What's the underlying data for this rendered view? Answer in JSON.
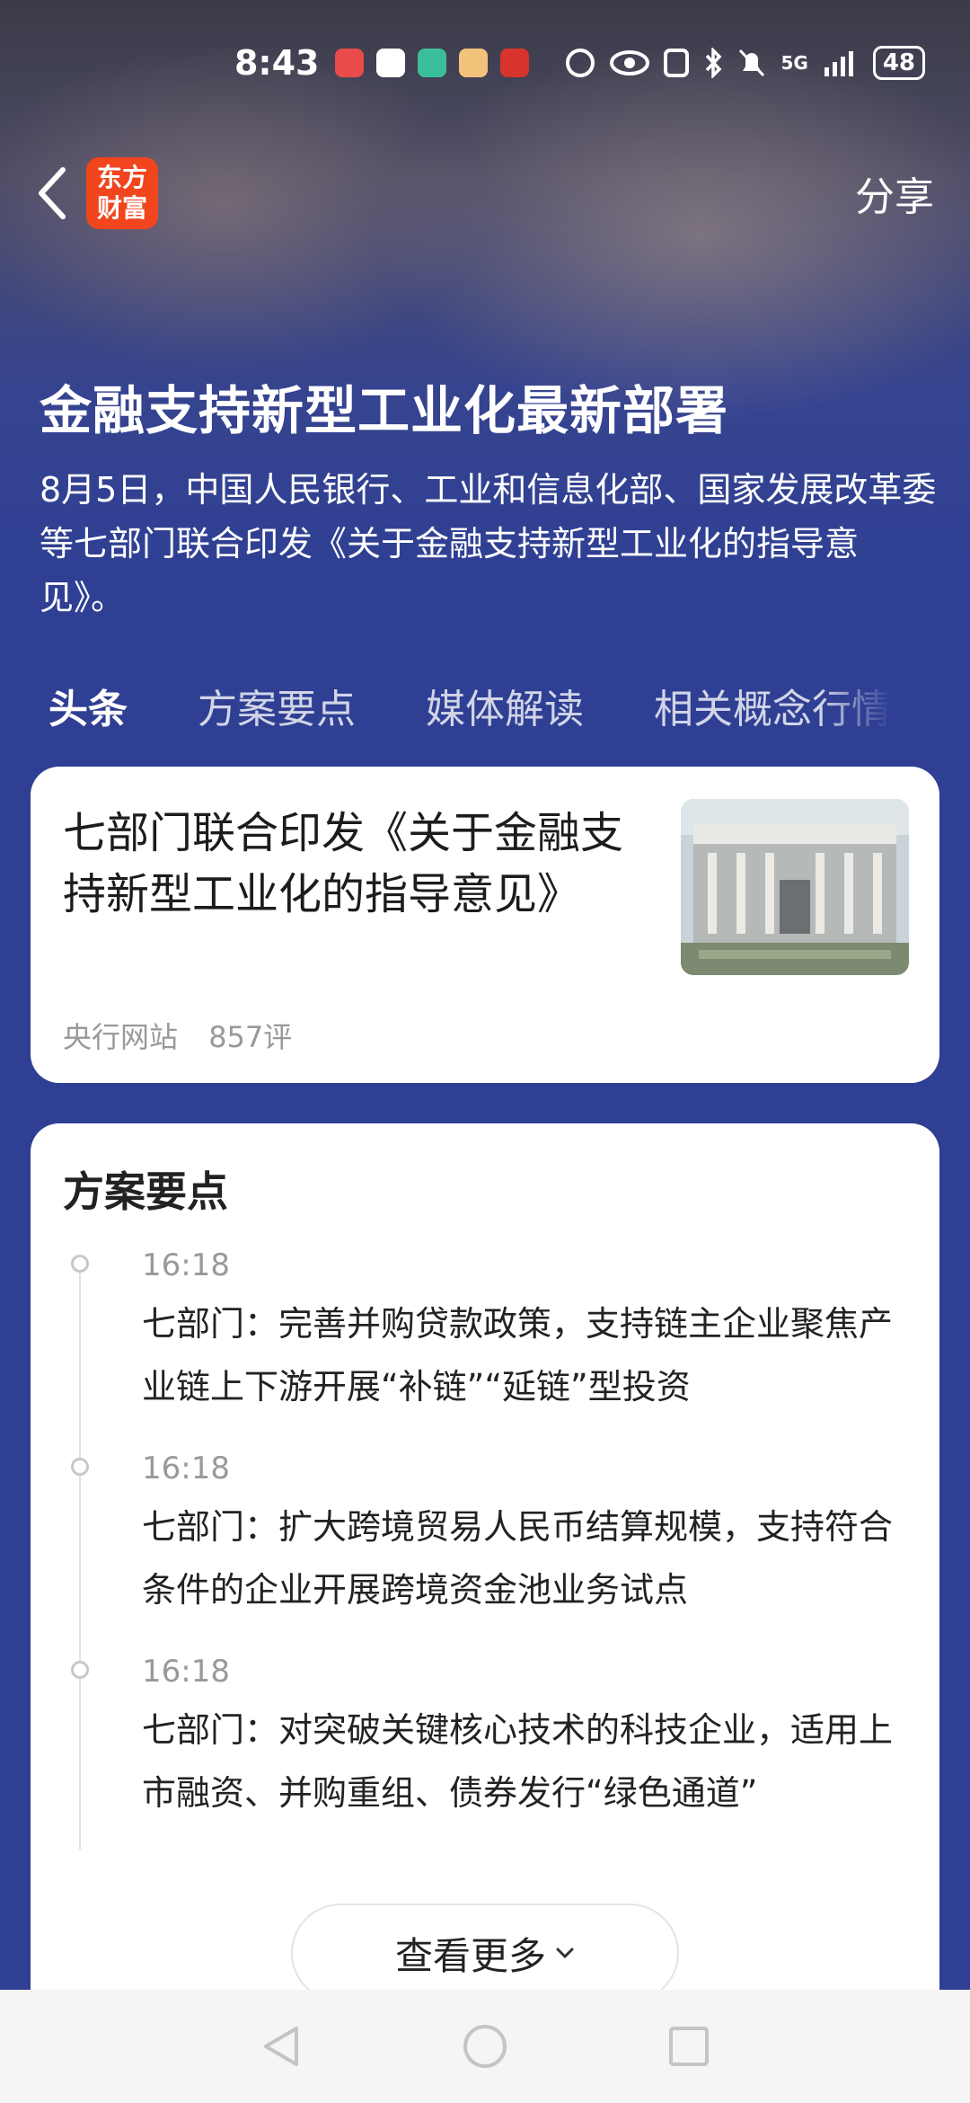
{
  "status_bar": {
    "time": "8:43",
    "signal": "5G",
    "battery": "48"
  },
  "header": {
    "logo_text_line1": "东方",
    "logo_text_line2": "财富",
    "share_label": "分享"
  },
  "topic": {
    "title": "金融支持新型工业化最新部署",
    "summary": "8月5日，中国人民银行、工业和信息化部、国家发展改革委等七部门联合印发《关于金融支持新型工业化的指导意见》。"
  },
  "tabs": [
    {
      "label": "头条",
      "active": true
    },
    {
      "label": "方案要点",
      "active": false
    },
    {
      "label": "媒体解读",
      "active": false
    },
    {
      "label": "相关概念行情",
      "active": false
    }
  ],
  "news": {
    "title": "七部门联合印发《关于金融支持新型工业化的指导意见》",
    "source": "央行网站",
    "comments": "857评"
  },
  "points": {
    "heading": "方案要点",
    "items": [
      {
        "time": "16:18",
        "text": "七部门：完善并购贷款政策，支持链主企业聚焦产业链上下游开展“补链”“延链”型投资"
      },
      {
        "time": "16:18",
        "text": "七部门：扩大跨境贸易人民币结算规模，支持符合条件的企业开展跨境资金池业务试点"
      },
      {
        "time": "16:18",
        "text": "七部门：对突破关键核心技术的科技企业，适用上市融资、并购重组、债券发行“绿色通道”"
      }
    ],
    "more_label": "查看更多"
  },
  "colors": {
    "brand": "#f0451d",
    "theme_blue": "#2f3f93"
  }
}
